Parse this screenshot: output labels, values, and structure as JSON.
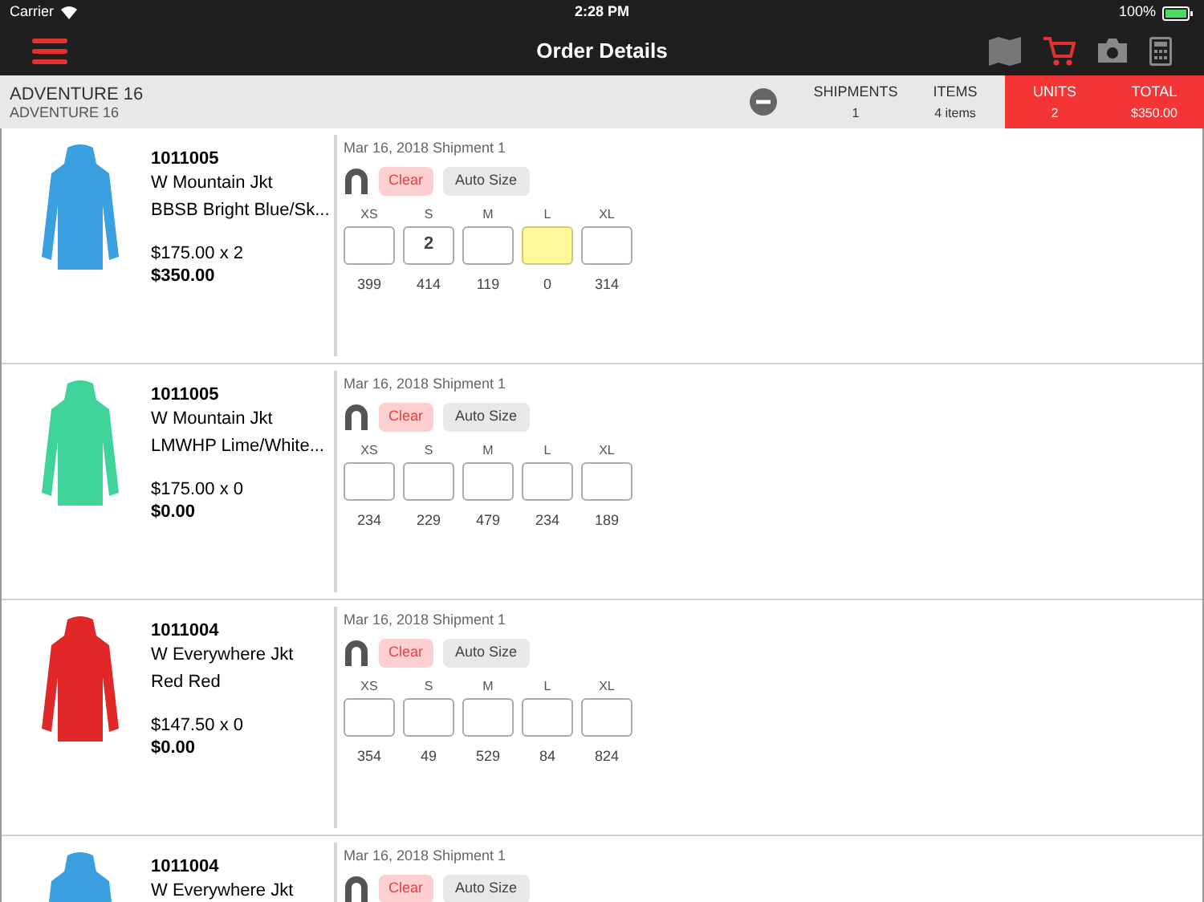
{
  "status_bar": {
    "carrier": "Carrier",
    "time": "2:28 PM",
    "battery": "100%"
  },
  "nav": {
    "title": "Order Details",
    "cart_active": true
  },
  "customer": {
    "name": "ADVENTURE 16",
    "subtitle": "ADVENTURE 16"
  },
  "summary": [
    {
      "label": "SHIPMENTS",
      "value": "1",
      "highlighted": false
    },
    {
      "label": "ITEMS",
      "value": "4 items",
      "highlighted": false
    },
    {
      "label": "UNITS",
      "value": "2",
      "highlighted": true
    },
    {
      "label": "TOTAL",
      "value": "$350.00",
      "highlighted": true
    }
  ],
  "items": [
    {
      "sku": "1011005",
      "name": "W Mountain Jkt",
      "color_name": "BBSB Bright Blue/Sk...",
      "price": "$175.00 x 2",
      "total": "$350.00",
      "color": "#3aa0e0",
      "shipment": "Mar 16, 2018 Shipment 1",
      "clear": "Clear",
      "auto_size": "Auto Size",
      "sizes": [
        {
          "size": "XS",
          "stock": "399",
          "highlighted": false
        },
        {
          "size": "S",
          "qty": "2",
          "stock": "414",
          "highlighted": false
        },
        {
          "size": "M",
          "stock": "119",
          "highlighted": false
        },
        {
          "size": "L",
          "stock": "0",
          "highlighted": true
        },
        {
          "size": "XL",
          "stock": "314",
          "highlighted": false
        }
      ]
    },
    {
      "sku": "1011005",
      "name": "W Mountain Jkt",
      "color_name": "LMWHP Lime/White...",
      "price": "$175.00 x 0",
      "total": "$0.00",
      "color": "#3fd39a",
      "shipment": "Mar 16, 2018 Shipment 1",
      "clear": "Clear",
      "auto_size": "Auto Size",
      "sizes": [
        {
          "size": "XS",
          "stock": "234",
          "highlighted": false
        },
        {
          "size": "S",
          "stock": "229",
          "highlighted": false
        },
        {
          "size": "M",
          "stock": "479",
          "highlighted": false
        },
        {
          "size": "L",
          "stock": "234",
          "highlighted": false
        },
        {
          "size": "XL",
          "stock": "189",
          "highlighted": false
        }
      ]
    },
    {
      "sku": "1011004",
      "name": "W Everywhere Jkt",
      "color_name": "Red Red",
      "price": "$147.50 x 0",
      "total": "$0.00",
      "color": "#e02828",
      "shipment": "Mar 16, 2018 Shipment 1",
      "clear": "Clear",
      "auto_size": "Auto Size",
      "sizes": [
        {
          "size": "XS",
          "stock": "354",
          "highlighted": false
        },
        {
          "size": "S",
          "stock": "49",
          "highlighted": false
        },
        {
          "size": "M",
          "stock": "529",
          "highlighted": false
        },
        {
          "size": "L",
          "stock": "84",
          "highlighted": false
        },
        {
          "size": "XL",
          "stock": "824",
          "highlighted": false
        }
      ]
    },
    {
      "sku": "1011004",
      "name": "W Everywhere Jkt",
      "color": "#3aa0e0",
      "shipment": "Mar 16, 2018 Shipment 1",
      "clear": "Clear",
      "auto_size": "Auto Size"
    }
  ]
}
